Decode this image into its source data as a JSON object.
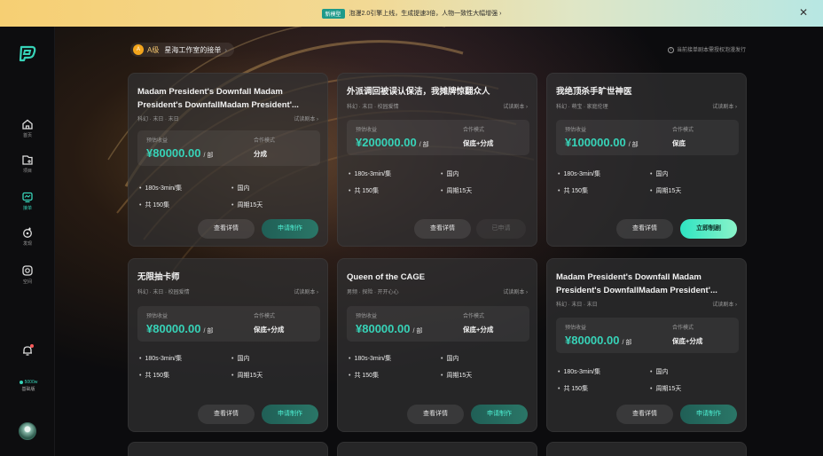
{
  "announcement": {
    "tag": "新模型",
    "text": "泡漫2.0引擎上线，生成提速3倍，人物一致性大幅增强 ›",
    "close": "✕"
  },
  "sidebar": {
    "logo_label": "P",
    "items": [
      {
        "label": "首页",
        "icon": "home-icon"
      },
      {
        "label": "项目",
        "icon": "project-icon"
      },
      {
        "label": "接单",
        "icon": "orders-icon"
      },
      {
        "label": "发现",
        "icon": "discover-icon"
      },
      {
        "label": "空间",
        "icon": "space-icon"
      }
    ],
    "credits_amount": "5000w",
    "credits_plan": "基础版",
    "accent": "#37d3b8"
  },
  "header": {
    "level_badge": "A",
    "level_text": "A级",
    "studio_text": "星海工作室的接单",
    "chevron": "›",
    "notice": "当前接单剧本需授权泡漫发行"
  },
  "labels": {
    "earn_key": "预估收益",
    "mode_key": "合作模式",
    "unit": "/ 部",
    "trial": "试读剧本 ›",
    "detail_btn": "查看详情",
    "apply_btn": "申请制作",
    "applied_btn": "已申请",
    "now_btn": "立即制剧"
  },
  "cards": [
    {
      "title": "Madam President's Downfall Madam President's DownfallMadam President'...",
      "tags": "科幻 · 末日 · 末日",
      "amount": "¥80000.00",
      "mode": "分成",
      "spec1": "180s-3min/集",
      "spec2": "国内",
      "spec3": "共 150集",
      "spec4": "周期15天"
    },
    {
      "title": "外派调回被误认保洁，我摊牌惊翻众人",
      "tags": "科幻 · 末日 · 校园爱情",
      "amount": "¥200000.00",
      "mode": "保底+分成",
      "spec1": "180s-3min/集",
      "spec2": "国内",
      "spec3": "共 150集",
      "spec4": "周期15天"
    },
    {
      "title": "我绝顶杀手旷世神医",
      "tags": "科幻 · 萌宝 · 家庭伦理",
      "amount": "¥100000.00",
      "mode": "保底",
      "spec1": "180s-3min/集",
      "spec2": "国内",
      "spec3": "共 150集",
      "spec4": "周期15天"
    },
    {
      "title": "无限抽卡师",
      "tags": "科幻 · 末日 · 校园爱情",
      "amount": "¥80000.00",
      "mode": "保底+分成",
      "spec1": "180s-3min/集",
      "spec2": "国内",
      "spec3": "共 150集",
      "spec4": "周期15天"
    },
    {
      "title": "Queen of the CAGE",
      "tags": "男频 · 探险 · 开开心心",
      "amount": "¥80000.00",
      "mode": "保底+分成",
      "spec1": "180s-3min/集",
      "spec2": "国内",
      "spec3": "共 150集",
      "spec4": "周期15天"
    },
    {
      "title": "Madam President's Downfall Madam President's DownfallMadam President'...",
      "tags": "科幻 · 末日 · 末日",
      "amount": "¥80000.00",
      "mode": "保底+分成",
      "spec1": "180s-3min/集",
      "spec2": "国内",
      "spec3": "共 150集",
      "spec4": "周期15天"
    }
  ]
}
